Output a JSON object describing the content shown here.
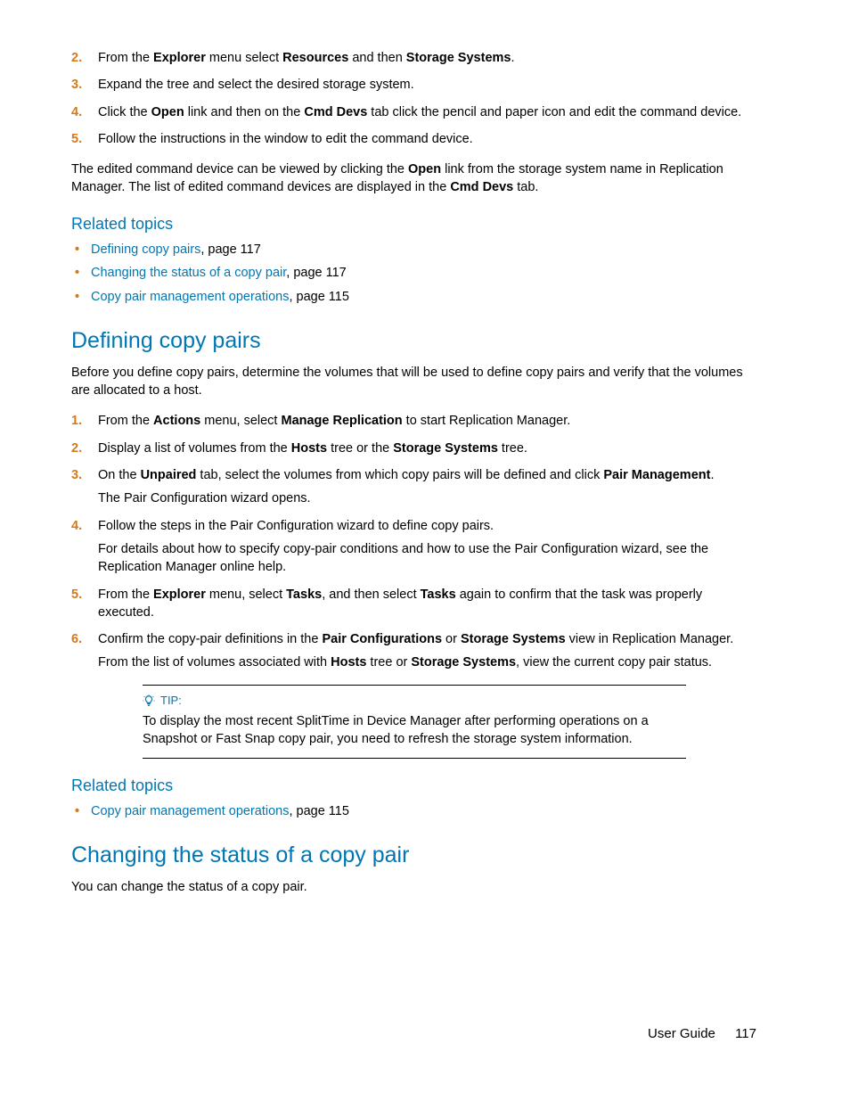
{
  "steps_top": [
    {
      "n": "2.",
      "html": "From the <b>Explorer</b> menu select <b>Resources</b> and then <b>Storage Systems</b>."
    },
    {
      "n": "3.",
      "html": "Expand the tree and select the desired storage system."
    },
    {
      "n": "4.",
      "html": "Click the <b>Open</b> link and then on the <b>Cmd Devs</b> tab click the pencil and paper icon and edit the command device."
    },
    {
      "n": "5.",
      "html": "Follow the instructions in the window to edit the command device."
    }
  ],
  "para_after_top": "The edited command device can be viewed by clicking the <b>Open</b> link from the storage system name in Replication Manager. The list of edited command devices are displayed in the <b>Cmd Devs</b> tab.",
  "related1_title": "Related topics",
  "related1_items": [
    {
      "link": "Defining copy pairs",
      "suffix": ", page 117"
    },
    {
      "link": "Changing the status of a copy pair",
      "suffix": ", page 117"
    },
    {
      "link": "Copy pair management operations",
      "suffix": ", page 115"
    }
  ],
  "section1_title": "Defining copy pairs",
  "section1_intro": "Before you define copy pairs, determine the volumes that will be used to define copy pairs and verify that the volumes are allocated to a host.",
  "section1_steps": [
    {
      "n": "1.",
      "html": "From the <b>Actions</b> menu, select <b>Manage Replication</b> to start Replication Manager."
    },
    {
      "n": "2.",
      "html": "Display a list of volumes from the <b>Hosts</b> tree or the <b>Storage Systems</b> tree."
    },
    {
      "n": "3.",
      "html": "On the <b>Unpaired</b> tab, select the volumes from which copy pairs will be defined and click <b>Pair Management</b>.",
      "after": "The Pair Configuration wizard opens."
    },
    {
      "n": "4.",
      "html": "Follow the steps in the Pair Configuration wizard to define copy pairs.",
      "after": "For details about how to specify copy-pair conditions and how to use the Pair Configuration wizard, see the Replication Manager online help."
    },
    {
      "n": "5.",
      "html": "From the <b>Explorer</b> menu, select <b>Tasks</b>, and then select <b>Tasks</b> again to confirm that the task was properly executed."
    },
    {
      "n": "6.",
      "html": "Confirm the copy-pair definitions in the <b>Pair Configurations</b> or <b>Storage Systems</b> view in Replication Manager.",
      "after": "From the list of volumes associated with <b>Hosts</b> tree or <b>Storage Systems</b>, view the current copy pair status."
    }
  ],
  "tip_label": "TIP:",
  "tip_body": "To display the most recent SplitTime in Device Manager after performing operations on a Snapshot or Fast Snap copy pair, you need to refresh the storage system information.",
  "related2_title": "Related topics",
  "related2_items": [
    {
      "link": "Copy pair management operations",
      "suffix": ", page 115"
    }
  ],
  "section2_title": "Changing the status of a copy pair",
  "section2_intro": "You can change the status of a copy pair.",
  "footer_label": "User Guide",
  "footer_page": "117"
}
